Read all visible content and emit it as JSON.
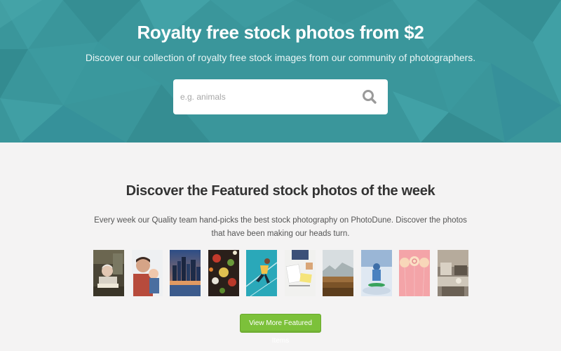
{
  "hero": {
    "title": "Royalty free stock photos from $2",
    "subtitle": "Discover our collection of royalty free stock images from our community of photographers.",
    "background_color": "#3a969b"
  },
  "search": {
    "placeholder": "e.g. animals",
    "icon": "search-icon"
  },
  "featured": {
    "title": "Discover the Featured stock photos of the week",
    "description": "Every week our Quality team hand-picks the best stock photography on PhotoDune. Discover the photos that have been making our heads turn.",
    "thumbnails": [
      {
        "subject": "elderly-woman-portrait"
      },
      {
        "subject": "father-and-baby"
      },
      {
        "subject": "city-skyline-at-dusk"
      },
      {
        "subject": "food-flat-lay"
      },
      {
        "subject": "athlete-on-blue-court"
      },
      {
        "subject": "desk-with-notes"
      },
      {
        "subject": "misty-field-landscape"
      },
      {
        "subject": "snow-sledding"
      },
      {
        "subject": "pink-balloons"
      },
      {
        "subject": "cozy-interior"
      }
    ],
    "button_label": "View More Featured Items",
    "button_color": "#7cc13a"
  }
}
